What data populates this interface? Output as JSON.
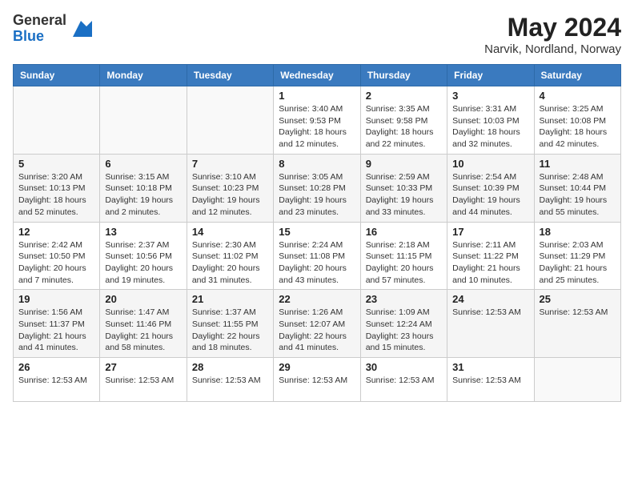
{
  "header": {
    "logo_general": "General",
    "logo_blue": "Blue",
    "month_year": "May 2024",
    "location": "Narvik, Nordland, Norway"
  },
  "days_of_week": [
    "Sunday",
    "Monday",
    "Tuesday",
    "Wednesday",
    "Thursday",
    "Friday",
    "Saturday"
  ],
  "weeks": [
    [
      {
        "day": "",
        "info": ""
      },
      {
        "day": "",
        "info": ""
      },
      {
        "day": "",
        "info": ""
      },
      {
        "day": "1",
        "info": "Sunrise: 3:40 AM\nSunset: 9:53 PM\nDaylight: 18 hours\nand 12 minutes."
      },
      {
        "day": "2",
        "info": "Sunrise: 3:35 AM\nSunset: 9:58 PM\nDaylight: 18 hours\nand 22 minutes."
      },
      {
        "day": "3",
        "info": "Sunrise: 3:31 AM\nSunset: 10:03 PM\nDaylight: 18 hours\nand 32 minutes."
      },
      {
        "day": "4",
        "info": "Sunrise: 3:25 AM\nSunset: 10:08 PM\nDaylight: 18 hours\nand 42 minutes."
      }
    ],
    [
      {
        "day": "5",
        "info": "Sunrise: 3:20 AM\nSunset: 10:13 PM\nDaylight: 18 hours\nand 52 minutes."
      },
      {
        "day": "6",
        "info": "Sunrise: 3:15 AM\nSunset: 10:18 PM\nDaylight: 19 hours\nand 2 minutes."
      },
      {
        "day": "7",
        "info": "Sunrise: 3:10 AM\nSunset: 10:23 PM\nDaylight: 19 hours\nand 12 minutes."
      },
      {
        "day": "8",
        "info": "Sunrise: 3:05 AM\nSunset: 10:28 PM\nDaylight: 19 hours\nand 23 minutes."
      },
      {
        "day": "9",
        "info": "Sunrise: 2:59 AM\nSunset: 10:33 PM\nDaylight: 19 hours\nand 33 minutes."
      },
      {
        "day": "10",
        "info": "Sunrise: 2:54 AM\nSunset: 10:39 PM\nDaylight: 19 hours\nand 44 minutes."
      },
      {
        "day": "11",
        "info": "Sunrise: 2:48 AM\nSunset: 10:44 PM\nDaylight: 19 hours\nand 55 minutes."
      }
    ],
    [
      {
        "day": "12",
        "info": "Sunrise: 2:42 AM\nSunset: 10:50 PM\nDaylight: 20 hours\nand 7 minutes."
      },
      {
        "day": "13",
        "info": "Sunrise: 2:37 AM\nSunset: 10:56 PM\nDaylight: 20 hours\nand 19 minutes."
      },
      {
        "day": "14",
        "info": "Sunrise: 2:30 AM\nSunset: 11:02 PM\nDaylight: 20 hours\nand 31 minutes."
      },
      {
        "day": "15",
        "info": "Sunrise: 2:24 AM\nSunset: 11:08 PM\nDaylight: 20 hours\nand 43 minutes."
      },
      {
        "day": "16",
        "info": "Sunrise: 2:18 AM\nSunset: 11:15 PM\nDaylight: 20 hours\nand 57 minutes."
      },
      {
        "day": "17",
        "info": "Sunrise: 2:11 AM\nSunset: 11:22 PM\nDaylight: 21 hours\nand 10 minutes."
      },
      {
        "day": "18",
        "info": "Sunrise: 2:03 AM\nSunset: 11:29 PM\nDaylight: 21 hours\nand 25 minutes."
      }
    ],
    [
      {
        "day": "19",
        "info": "Sunrise: 1:56 AM\nSunset: 11:37 PM\nDaylight: 21 hours\nand 41 minutes."
      },
      {
        "day": "20",
        "info": "Sunrise: 1:47 AM\nSunset: 11:46 PM\nDaylight: 21 hours\nand 58 minutes."
      },
      {
        "day": "21",
        "info": "Sunrise: 1:37 AM\nSunset: 11:55 PM\nDaylight: 22 hours\nand 18 minutes."
      },
      {
        "day": "22",
        "info": "Sunrise: 1:26 AM\nSunset: 12:07 AM\nDaylight: 22 hours\nand 41 minutes."
      },
      {
        "day": "23",
        "info": "Sunrise: 1:09 AM\nSunset: 12:24 AM\nDaylight: 23 hours\nand 15 minutes."
      },
      {
        "day": "24",
        "info": "Sunrise: 12:53 AM"
      },
      {
        "day": "25",
        "info": "Sunrise: 12:53 AM"
      }
    ],
    [
      {
        "day": "26",
        "info": "Sunrise: 12:53 AM"
      },
      {
        "day": "27",
        "info": "Sunrise: 12:53 AM"
      },
      {
        "day": "28",
        "info": "Sunrise: 12:53 AM"
      },
      {
        "day": "29",
        "info": "Sunrise: 12:53 AM"
      },
      {
        "day": "30",
        "info": "Sunrise: 12:53 AM"
      },
      {
        "day": "31",
        "info": "Sunrise: 12:53 AM"
      },
      {
        "day": "",
        "info": ""
      }
    ]
  ]
}
